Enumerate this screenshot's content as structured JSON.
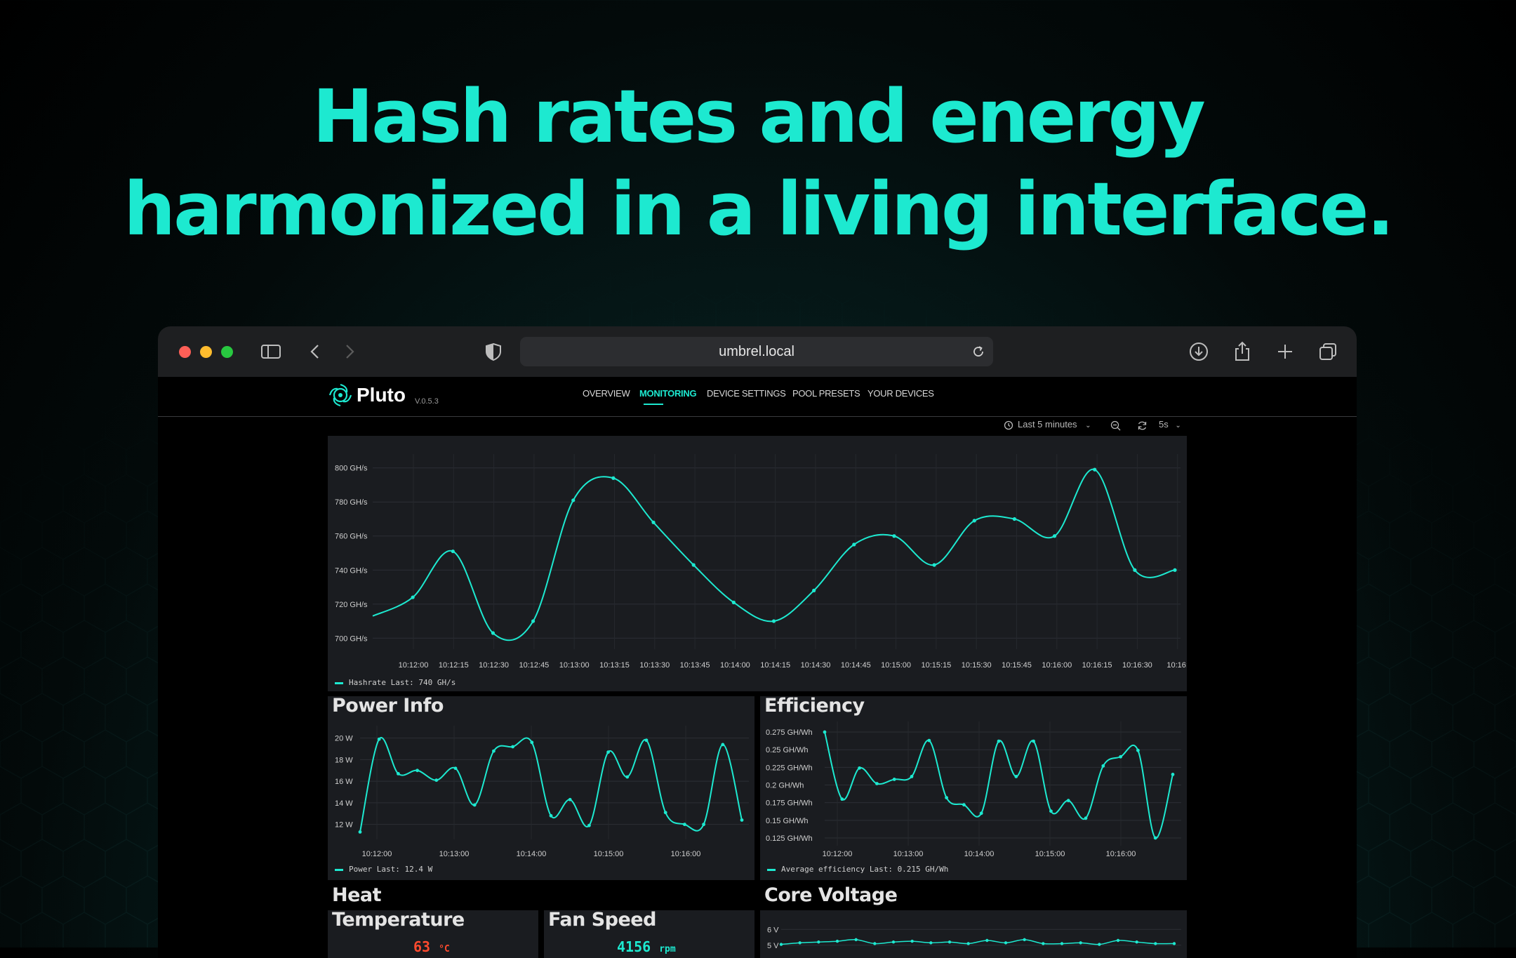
{
  "headline": {
    "line1": "Hash rates and energy",
    "line2": "harmonized in a living interface."
  },
  "colors": {
    "accent": "#1de9d0",
    "background": "#000000",
    "panel": "#1a1c20",
    "temp": "#ff4a2e"
  },
  "browser": {
    "url": "umbrel.local",
    "icons": [
      "sidebar-icon",
      "back-icon",
      "forward-icon",
      "shield-icon",
      "reload-icon",
      "download-icon",
      "share-icon",
      "new-tab-icon",
      "tabs-icon"
    ]
  },
  "app": {
    "name": "Pluto",
    "version": "V.0.5.3",
    "nav": [
      "OVERVIEW",
      "MONITORING",
      "DEVICE SETTINGS",
      "POOL PRESETS",
      "YOUR DEVICES"
    ],
    "active_nav": "MONITORING",
    "time_range": "Last 5 minutes",
    "refresh_interval": "5s"
  },
  "panels": {
    "power_title": "Power Info",
    "efficiency_title": "Efficiency",
    "heat_title": "Heat",
    "temperature_title": "Temperature",
    "fan_title": "Fan Speed",
    "voltage_title": "Core Voltage",
    "temperature_value": "63",
    "temperature_unit": "°C",
    "fan_value": "4156",
    "fan_unit": "rpm"
  },
  "chart_data": [
    {
      "type": "line",
      "name": "hashrate",
      "yticks": [
        "800 GH/s",
        "780 GH/s",
        "760 GH/s",
        "740 GH/s",
        "720 GH/s",
        "700 GH/s"
      ],
      "xticks": [
        "10:12:00",
        "10:12:15",
        "10:12:30",
        "10:12:45",
        "10:13:00",
        "10:13:15",
        "10:13:30",
        "10:13:45",
        "10:14:00",
        "10:14:15",
        "10:14:30",
        "10:14:45",
        "10:15:00",
        "10:15:15",
        "10:15:30",
        "10:15:45",
        "10:16:00",
        "10:16:15",
        "10:16:30",
        "10:16:"
      ],
      "ylim": [
        696,
        804
      ],
      "series": [
        {
          "name": "Hashrate",
          "legend": "Hashrate Last: 740 GH/s",
          "values": [
            713,
            724,
            751,
            703,
            710,
            781,
            794,
            768,
            743,
            721,
            710,
            728,
            755,
            760,
            743,
            769,
            770,
            760,
            799,
            740,
            740
          ]
        }
      ]
    },
    {
      "type": "line",
      "name": "power",
      "yticks": [
        "20 W",
        "18 W",
        "16 W",
        "14 W",
        "12 W"
      ],
      "xticks": [
        "10:12:00",
        "10:13:00",
        "10:14:00",
        "10:15:00",
        "10:16:00"
      ],
      "ylim": [
        11,
        20.5
      ],
      "series": [
        {
          "name": "Power",
          "legend": "Power Last: 12.4 W",
          "values": [
            11.3,
            19.9,
            16.7,
            17.0,
            16.1,
            17.2,
            13.8,
            18.8,
            19.2,
            19.6,
            12.8,
            14.3,
            11.9,
            18.7,
            16.4,
            19.8,
            13.1,
            12.0,
            12.0,
            19.4,
            12.4
          ]
        }
      ]
    },
    {
      "type": "line",
      "name": "efficiency",
      "yticks": [
        "0.275 GH/Wh",
        "0.25 GH/Wh",
        "0.225 GH/Wh",
        "0.2 GH/Wh",
        "0.175 GH/Wh",
        "0.15 GH/Wh",
        "0.125 GH/Wh"
      ],
      "xticks": [
        "10:12:00",
        "10:13:00",
        "10:14:00",
        "10:15:00",
        "10:16:00"
      ],
      "ylim": [
        0.12,
        0.28
      ],
      "series": [
        {
          "name": "Average efficiency",
          "legend": "Average efficiency Last: 0.215 GH/Wh",
          "values": [
            0.275,
            0.18,
            0.224,
            0.202,
            0.208,
            0.212,
            0.263,
            0.182,
            0.172,
            0.16,
            0.262,
            0.212,
            0.262,
            0.163,
            0.178,
            0.153,
            0.227,
            0.24,
            0.249,
            0.125,
            0.215
          ]
        }
      ]
    },
    {
      "type": "line",
      "name": "core-voltage",
      "yticks": [
        "6 V",
        "5 V"
      ],
      "ylim": [
        4.9,
        6.1
      ],
      "series": [
        {
          "name": "Core Voltage",
          "values": [
            5.05,
            5.15,
            5.2,
            5.25,
            5.35,
            5.1,
            5.2,
            5.25,
            5.15,
            5.2,
            5.1,
            5.3,
            5.15,
            5.35,
            5.1,
            5.1,
            5.15,
            5.05,
            5.3,
            5.2,
            5.1,
            5.1
          ]
        }
      ]
    }
  ]
}
